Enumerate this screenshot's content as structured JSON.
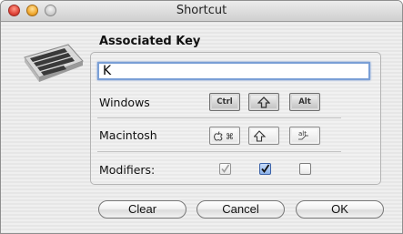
{
  "window": {
    "title": "Shortcut"
  },
  "section": {
    "title": "Associated Key"
  },
  "key_field": {
    "value": "K"
  },
  "rows": {
    "windows": {
      "label": "Windows",
      "keys": [
        "Ctrl",
        "Shift",
        "Alt"
      ]
    },
    "macintosh": {
      "label": "Macintosh",
      "keys": [
        "Command",
        "Shift",
        "Option"
      ]
    },
    "modifiers": {
      "label": "Modifiers:",
      "states": [
        "checked-disabled",
        "checked",
        "unchecked"
      ]
    }
  },
  "mac_key_glyphs": {
    "command": "⌘",
    "shift": "⇧",
    "option": "alt"
  },
  "buttons": {
    "clear": "Clear",
    "cancel": "Cancel",
    "ok": "OK"
  },
  "colors": {
    "check_blue": "#2a58a8",
    "focus_ring": "#7a9fd6"
  }
}
